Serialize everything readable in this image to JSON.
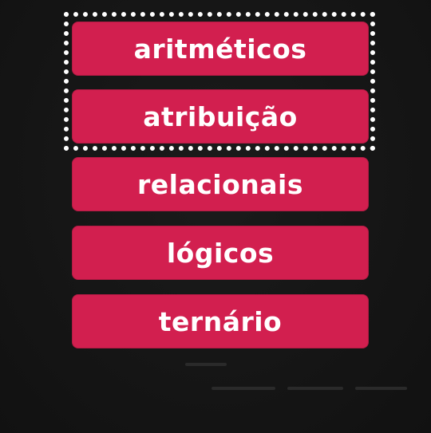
{
  "operator_list": {
    "items": [
      {
        "label": "aritméticos"
      },
      {
        "label": "atribuição"
      },
      {
        "label": "relacionais"
      },
      {
        "label": "lógicos"
      },
      {
        "label": "ternário"
      }
    ],
    "item_color": "#d21f4f",
    "text_color": "#ffffff",
    "background_color": "#151515",
    "selection_color": "#ffffff"
  }
}
